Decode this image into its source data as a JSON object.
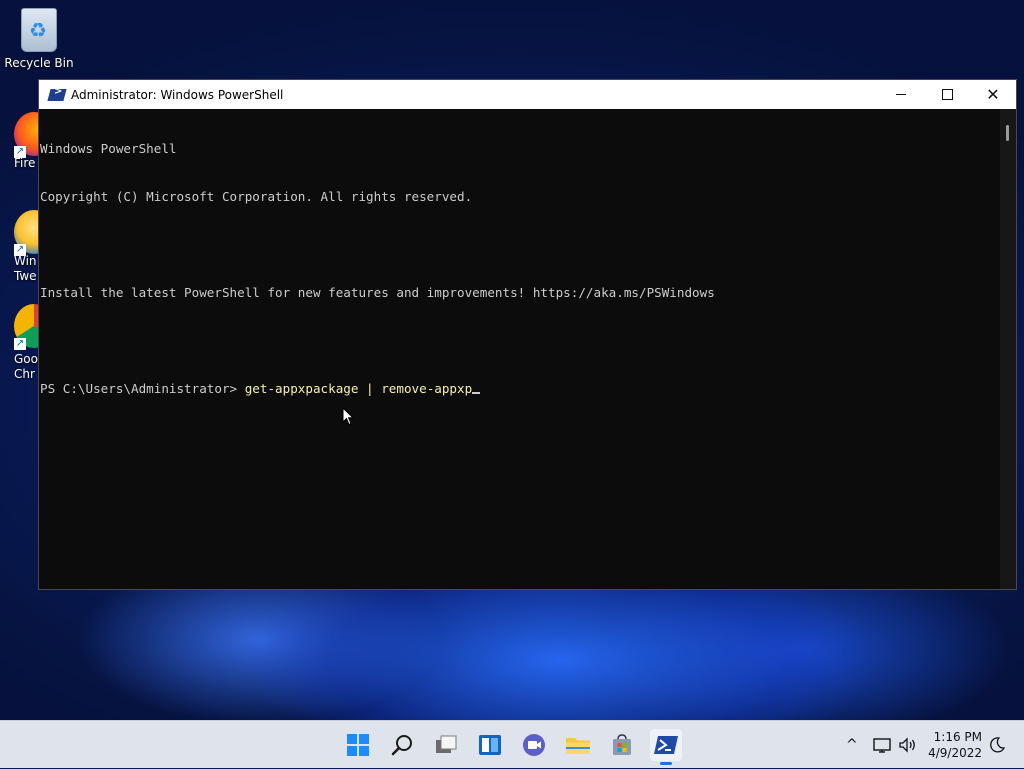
{
  "desktop": {
    "recycle_bin_label": "Recycle Bin",
    "side_labels": [
      {
        "l1": "Fire",
        "l2": ""
      },
      {
        "l1": "Win",
        "l2": "Twe"
      },
      {
        "l1": "Goo",
        "l2": "Chr"
      }
    ]
  },
  "window": {
    "title": "Administrator: Windows PowerShell",
    "controls": {
      "minimize": "minimize-icon",
      "maximize": "maximize-icon",
      "close": "close-icon"
    }
  },
  "console": {
    "line1": "Windows PowerShell",
    "line2": "Copyright (C) Microsoft Corporation. All rights reserved.",
    "line3": "",
    "line4": "Install the latest PowerShell for new features and improvements! https://aka.ms/PSWindows",
    "line5": "",
    "prompt": "PS C:\\Users\\Administrator> ",
    "command": "get-appxpackage | remove-appxp"
  },
  "taskbar": {
    "apps": [
      {
        "name": "start-icon"
      },
      {
        "name": "search-icon"
      },
      {
        "name": "task-view-icon"
      },
      {
        "name": "widgets-icon"
      },
      {
        "name": "chat-icon"
      },
      {
        "name": "file-explorer-icon"
      },
      {
        "name": "store-icon"
      },
      {
        "name": "powershell-icon"
      }
    ],
    "tray": {
      "chevron": "^",
      "time": "1:16 PM",
      "date": "4/9/2022"
    }
  },
  "colors": {
    "console_bg": "#0c0c0c",
    "console_text": "#cccccc",
    "command_text": "#f9f1a5",
    "accent": "#1a73e8"
  }
}
